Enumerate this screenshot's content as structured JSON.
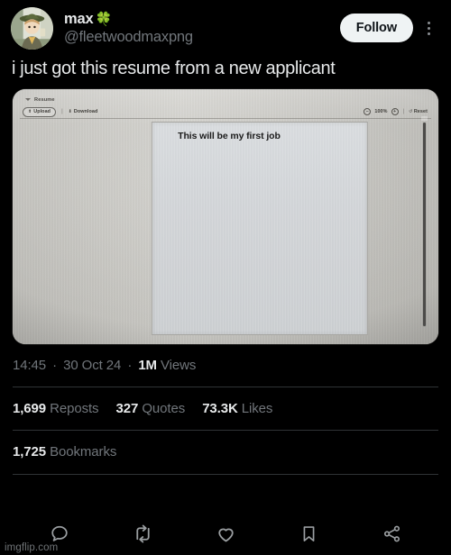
{
  "post": {
    "author": {
      "display_name": "max",
      "emoji": "🍀",
      "handle": "@fleetwoodmaxpng",
      "avatar_icon": "cartoon-character-green-hat-avatar"
    },
    "follow_label": "Follow",
    "more_menu_icon": "more-vertical-icon",
    "text": "i just got this resume from a new applicant",
    "timestamp": "14:45",
    "date": "30 Oct 24",
    "views_count": "1M",
    "views_label": "Views",
    "separator": "·"
  },
  "image": {
    "alt": "photo of a laptop screen showing a resume document app",
    "app": {
      "title": "Resume",
      "title_chevron_icon": "chevron-down-icon",
      "upload_label": "Upload",
      "upload_icon": "upload-icon",
      "download_label": "Download",
      "download_icon": "download-icon",
      "zoom_out_icon": "minus-circle-icon",
      "zoom_level": "100%",
      "zoom_in_icon": "plus-circle-icon",
      "toolbar_divider": "|",
      "reset_label": "Reset",
      "reset_icon": "rotate-ccw-icon"
    },
    "document_text": "This will be my first job"
  },
  "stats": [
    {
      "count": "1,699",
      "label": "Reposts"
    },
    {
      "count": "327",
      "label": "Quotes"
    },
    {
      "count": "73.3K",
      "label": "Likes"
    }
  ],
  "bookmarks": {
    "count": "1,725",
    "label": "Bookmarks"
  },
  "actions": [
    {
      "name": "reply-icon"
    },
    {
      "name": "retweet-icon"
    },
    {
      "name": "like-icon"
    },
    {
      "name": "bookmark-icon"
    },
    {
      "name": "share-icon"
    }
  ],
  "watermark": "imgflip.com",
  "colors": {
    "background": "#000000",
    "text_primary": "#e7e9ea",
    "text_secondary": "#71767b",
    "divider": "#2f3336",
    "follow_button_bg": "#eff3f4",
    "follow_button_text": "#0f1419",
    "photo_bg": "#cdccc8",
    "page_bg": "#d5d8da"
  }
}
